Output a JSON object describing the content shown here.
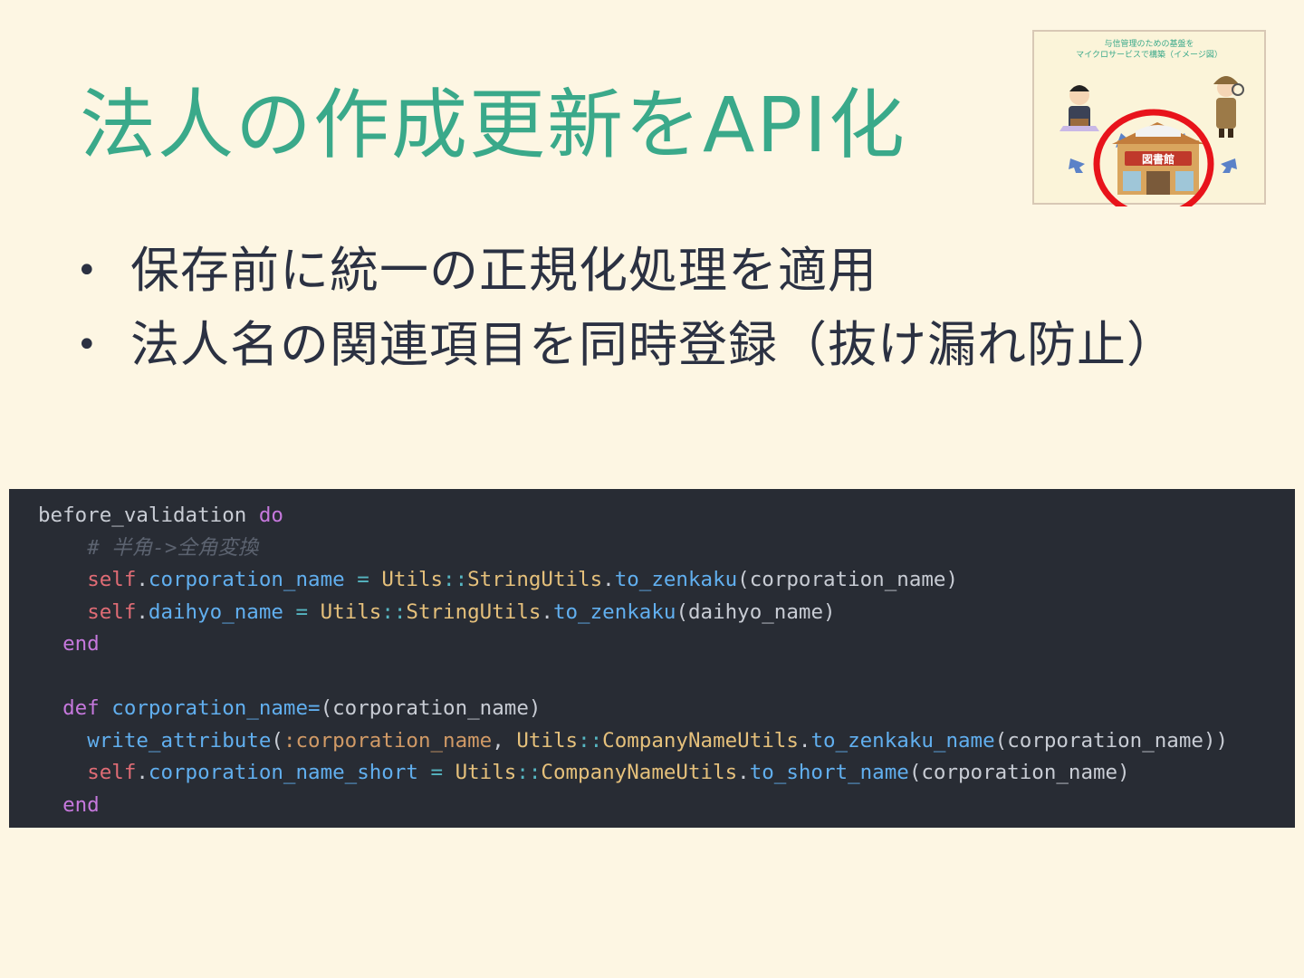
{
  "slide": {
    "title": "法人の作成更新をAPI化",
    "bullets": [
      "保存前に統一の正規化処理を適用",
      "法人名の関連項目を同時登録（抜け漏れ防止）"
    ],
    "bullet_symbol": "•"
  },
  "thumbnail": {
    "caption_line1": "与信管理のための基盤を",
    "caption_line2": "マイクロサービスで構築（イメージ図）",
    "building_sign": "図書館",
    "highlight_color": "#e8131b"
  },
  "code": {
    "tokens": {
      "before_validation": "before_validation",
      "do": "do",
      "comment": "# 半角->全角変換",
      "self": "self",
      "dot": ".",
      "corporation_name": "corporation_name",
      "eq": "=",
      "utils": "Utils",
      "sep": "::",
      "string_utils": "StringUtils",
      "to_zenkaku": "to_zenkaku",
      "arg_corporation_name": "(corporation_name)",
      "daihyo_name": "daihyo_name",
      "arg_daihyo_name": "(daihyo_name)",
      "end": "end",
      "def": "def",
      "setter": "corporation_name=",
      "write_attribute": "write_attribute",
      "paren_open": "(",
      "symbol_corporation_name": ":corporation_name",
      "comma": ",",
      "company_name_utils": "CompanyNameUtils",
      "to_zenkaku_name": "to_zenkaku_name",
      "close_double": "(corporation_name))",
      "corporation_name_short": "corporation_name_short",
      "to_short_name": "to_short_name"
    }
  }
}
